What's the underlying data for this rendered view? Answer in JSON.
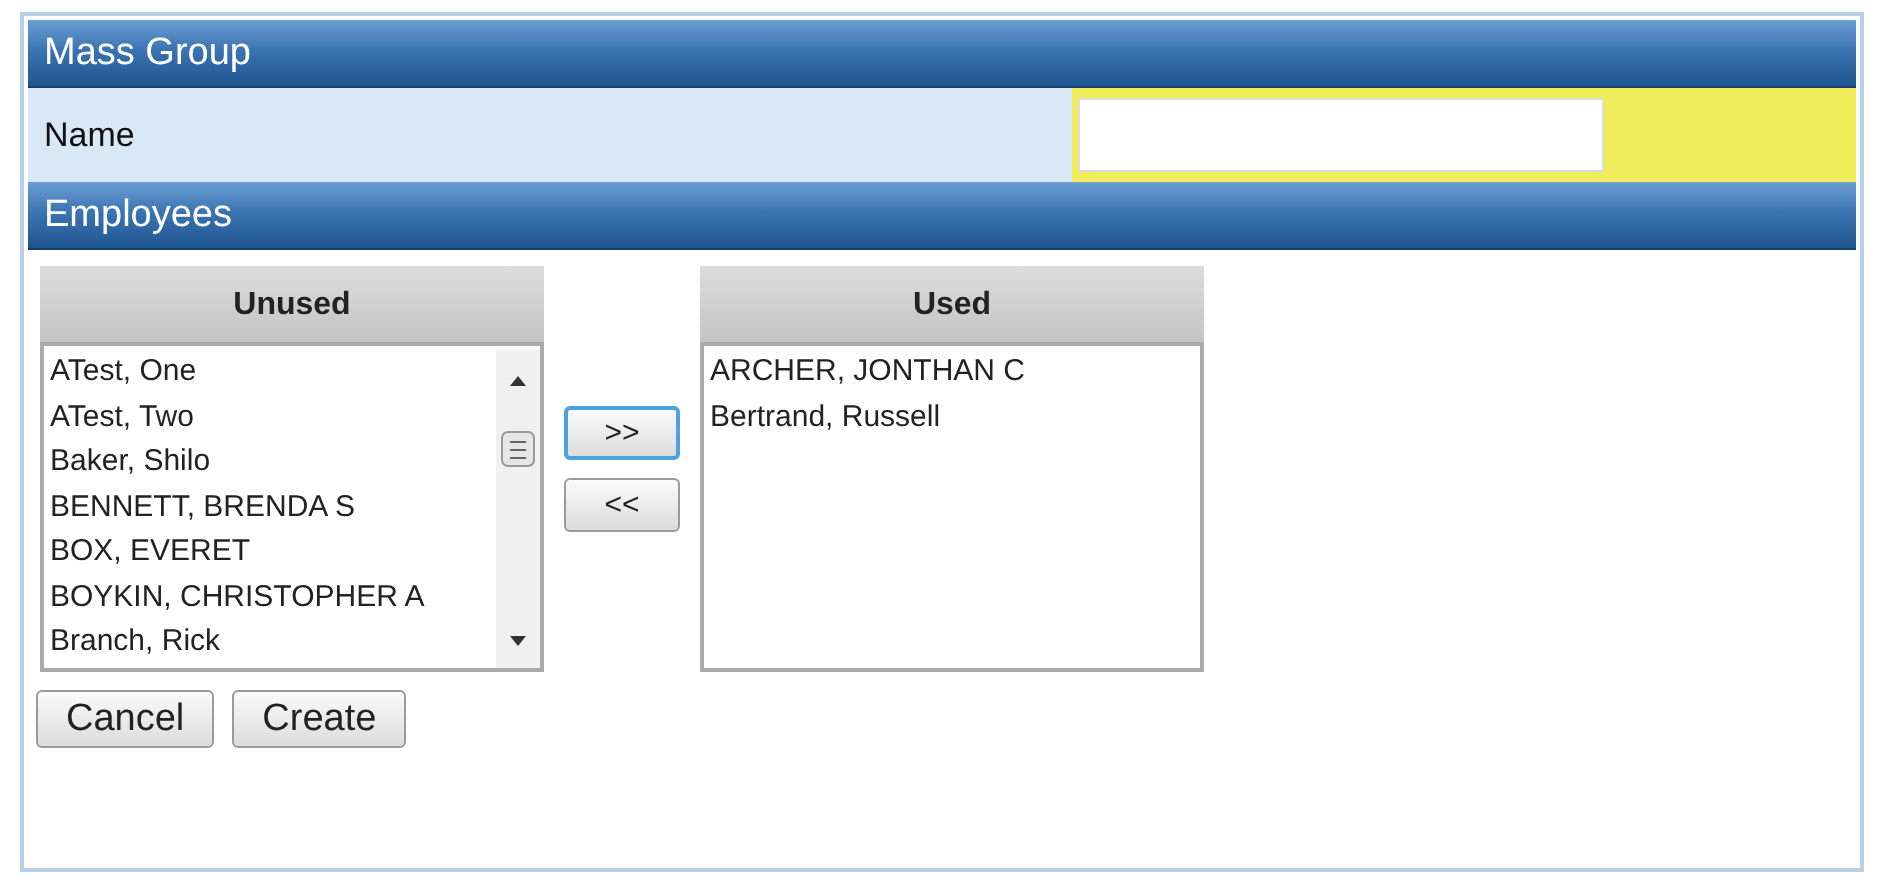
{
  "title": "Mass Group",
  "name_field": {
    "label": "Name"
  },
  "section": "Employees",
  "unused": {
    "heading": "Unused",
    "items": [
      "ATest, One",
      "ATest, Two",
      "Baker, Shilo",
      "BENNETT, BRENDA S",
      "BOX, EVERET",
      "BOYKIN, CHRISTOPHER A",
      "Branch, Rick"
    ]
  },
  "move_buttons": [
    {
      "label": ">>",
      "focused": true
    },
    {
      "label": "<<",
      "focused": false
    }
  ],
  "used": {
    "heading": "Used",
    "items": [
      "ARCHER, JONTHAN C",
      "Bertrand, Russell"
    ]
  },
  "actions": [
    "Cancel",
    "Create"
  ]
}
